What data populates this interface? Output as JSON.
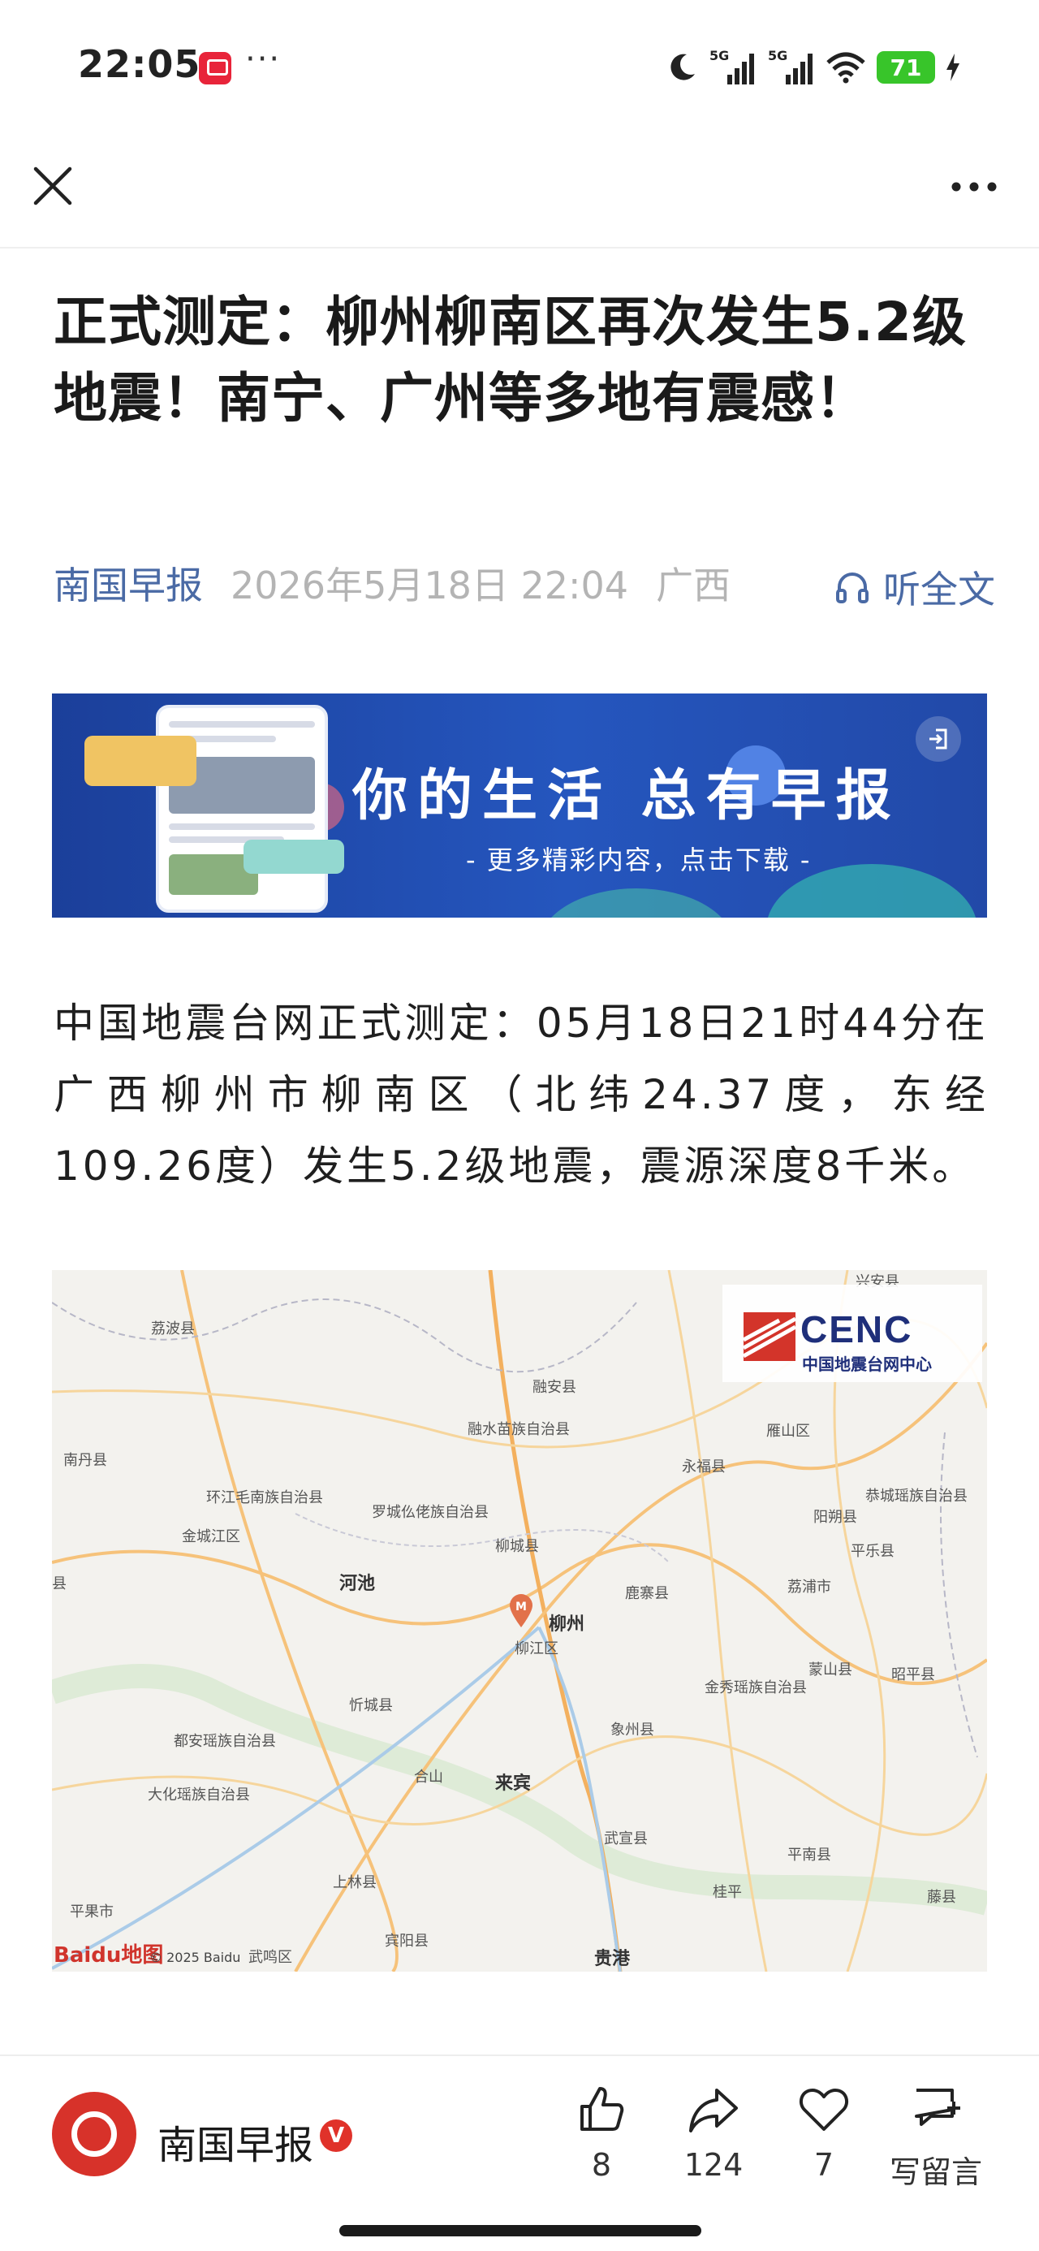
{
  "status_bar": {
    "time": "22:05",
    "more": "···",
    "signal_1": "5G",
    "signal_2": "5G",
    "battery": "71",
    "icons": [
      "app-notification-icon",
      "moon-icon",
      "signal-icon",
      "wifi-icon",
      "battery-icon",
      "charging-icon"
    ]
  },
  "nav": {
    "close_icon": "close-icon",
    "more_icon": "more-horizontal-icon"
  },
  "article": {
    "title": "正式测定：柳州柳南区再次发生5.2级地震！南宁、广州等多地有震感！",
    "source": "南国早报",
    "date": "2026年5月18日 22:04",
    "region": "广西",
    "listen_label": "听全文",
    "body": "中国地震台网正式测定：05月18日21时44分在广西柳州市柳南区（北纬24.37度，东经109.26度）发生5.2级地震，震源深度8千米。"
  },
  "banner": {
    "title": "你的生活 总有早报",
    "subtitle": "- 更多精彩内容，点击下载 -"
  },
  "map": {
    "logo_text": "CENC",
    "logo_cn": "中国地震台网中心",
    "epicenter_label": "M",
    "places": [
      {
        "name": "荔波县"
      },
      {
        "name": "融安县"
      },
      {
        "name": "融水苗族自治县"
      },
      {
        "name": "南丹县"
      },
      {
        "name": "永福县"
      },
      {
        "name": "雁山区"
      },
      {
        "name": "环江毛南族自治县"
      },
      {
        "name": "罗城仫佬族自治县"
      },
      {
        "name": "恭城瑶族自治县"
      },
      {
        "name": "金城江区"
      },
      {
        "name": "柳城县"
      },
      {
        "name": "阳朔县"
      },
      {
        "name": "平乐县"
      },
      {
        "name": "河池"
      },
      {
        "name": "鹿寨县"
      },
      {
        "name": "荔浦市"
      },
      {
        "name": "柳江区"
      },
      {
        "name": "金秀瑶族自治县"
      },
      {
        "name": "蒙山县"
      },
      {
        "name": "昭平县"
      },
      {
        "name": "忻城县"
      },
      {
        "name": "都安瑶族自治县"
      },
      {
        "name": "象州县"
      },
      {
        "name": "合山"
      },
      {
        "name": "大化瑶族自治县"
      },
      {
        "name": "武宣县"
      },
      {
        "name": "平南县"
      },
      {
        "name": "上林县"
      },
      {
        "name": "桂平"
      },
      {
        "name": "藤县"
      },
      {
        "name": "平果市"
      },
      {
        "name": "宾阳县"
      },
      {
        "name": "武鸣区"
      },
      {
        "name": "兴安县"
      },
      {
        "name": "县"
      }
    ],
    "cities": [
      {
        "name": "柳州"
      },
      {
        "name": "来宾"
      },
      {
        "name": "贵港"
      }
    ],
    "attribution": "Baidu地图",
    "copyright": "© 2025 Baidu"
  },
  "footer": {
    "account_name": "南国早报",
    "verified_badge": "V",
    "like_count": "8",
    "share_count": "124",
    "fav_count": "7",
    "comment_label": "写留言"
  }
}
